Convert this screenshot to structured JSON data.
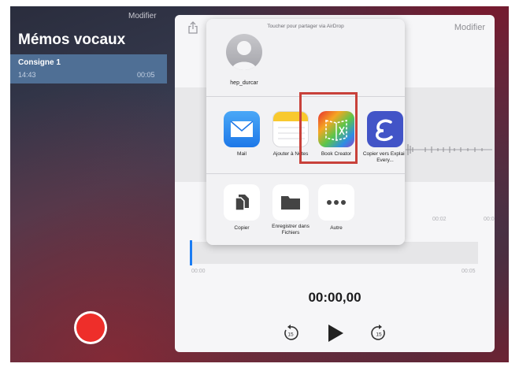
{
  "left_panel": {
    "modifier": "Modifier",
    "title": "Mémos vocaux",
    "memo": {
      "name": "Consigne 1",
      "time": "14:43",
      "duration": "00:05"
    }
  },
  "player": {
    "modifier": "Modifier",
    "waveform_ticks": [
      "00:02",
      "00:0"
    ],
    "mini_start": "00:00",
    "mini_end": "00:05",
    "timer": "00:00,00",
    "skip_back_label": "15",
    "skip_forward_label": "15",
    "playhead_position": 0
  },
  "share_sheet": {
    "airdrop_header": "Toucher pour partager via AirDrop",
    "contact_name": "hep_durcar",
    "apps": [
      {
        "label": "Mail",
        "icon": "mail-icon"
      },
      {
        "label": "Ajouter à Notes",
        "icon": "notes-icon"
      },
      {
        "label": "Book Creator",
        "icon": "book-creator-icon"
      },
      {
        "label": "Copier vers Explain Every...",
        "icon": "explain-everything-icon"
      }
    ],
    "actions": [
      {
        "label": "Copier",
        "icon": "copy-icon"
      },
      {
        "label": "Enregistrer dans Fichiers",
        "icon": "folder-icon"
      },
      {
        "label": "Autre",
        "icon": "more-icon"
      }
    ],
    "highlight_color": "#c8413a"
  },
  "colors": {
    "record": "#ee2e2a",
    "selected_row": "#4f6f95",
    "playhead": "#1b7cf3",
    "mail": "#1e88f0",
    "explain": "#4254c7"
  }
}
